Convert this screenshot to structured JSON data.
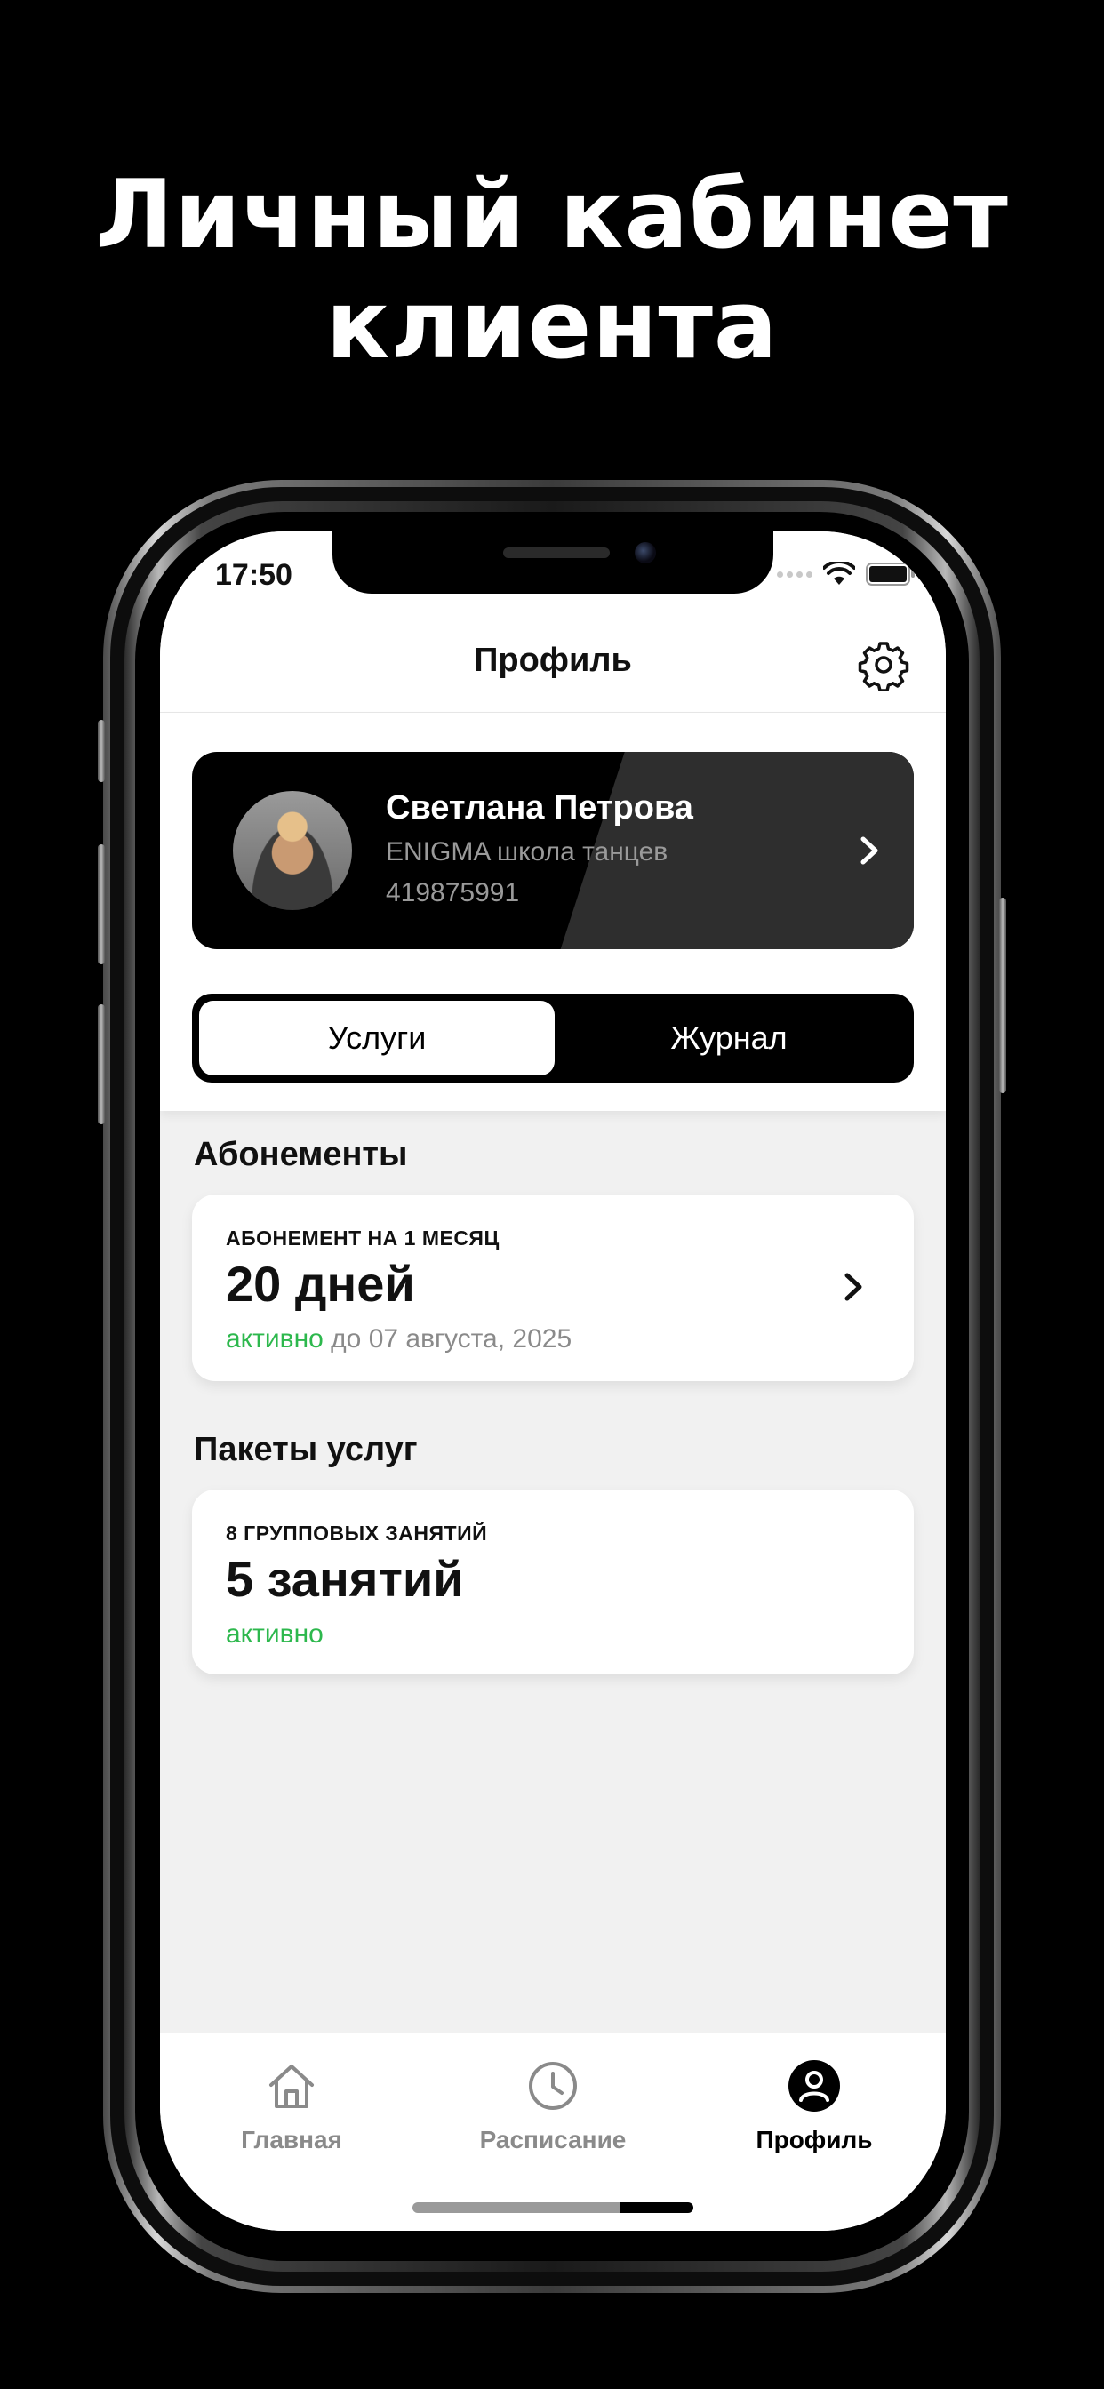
{
  "headline": {
    "line1": "Личный кабинет",
    "line2": "клиента"
  },
  "status_bar": {
    "time": "17:50",
    "icons": [
      "cellular-signal-icon",
      "wifi-icon",
      "battery-icon"
    ]
  },
  "nav": {
    "title": "Профиль",
    "settings_icon": "gear-icon"
  },
  "profile": {
    "name": "Светлана Петрова",
    "organization": "ENIGMA школа танцев",
    "client_id": "419875991"
  },
  "segments": {
    "active": "Услуги",
    "inactive": "Журнал"
  },
  "subscriptions": {
    "section_title": "Абонементы",
    "item": {
      "caption": "АБОНЕМЕНТ НА 1 МЕСЯЦ",
      "value": "20 дней",
      "status": "активно",
      "until": " до 07 августа, 2025"
    }
  },
  "packages": {
    "section_title": "Пакеты услуг",
    "item": {
      "caption": "8 ГРУППОВЫХ ЗАНЯТИЙ",
      "value": "5 занятий",
      "status": "активно"
    }
  },
  "tab_bar": {
    "home": "Главная",
    "schedule": "Расписание",
    "profile": "Профиль"
  },
  "colors": {
    "active_green": "#2db84d",
    "inactive_tab": "#8a8a8a",
    "active_tab": "#000000"
  }
}
